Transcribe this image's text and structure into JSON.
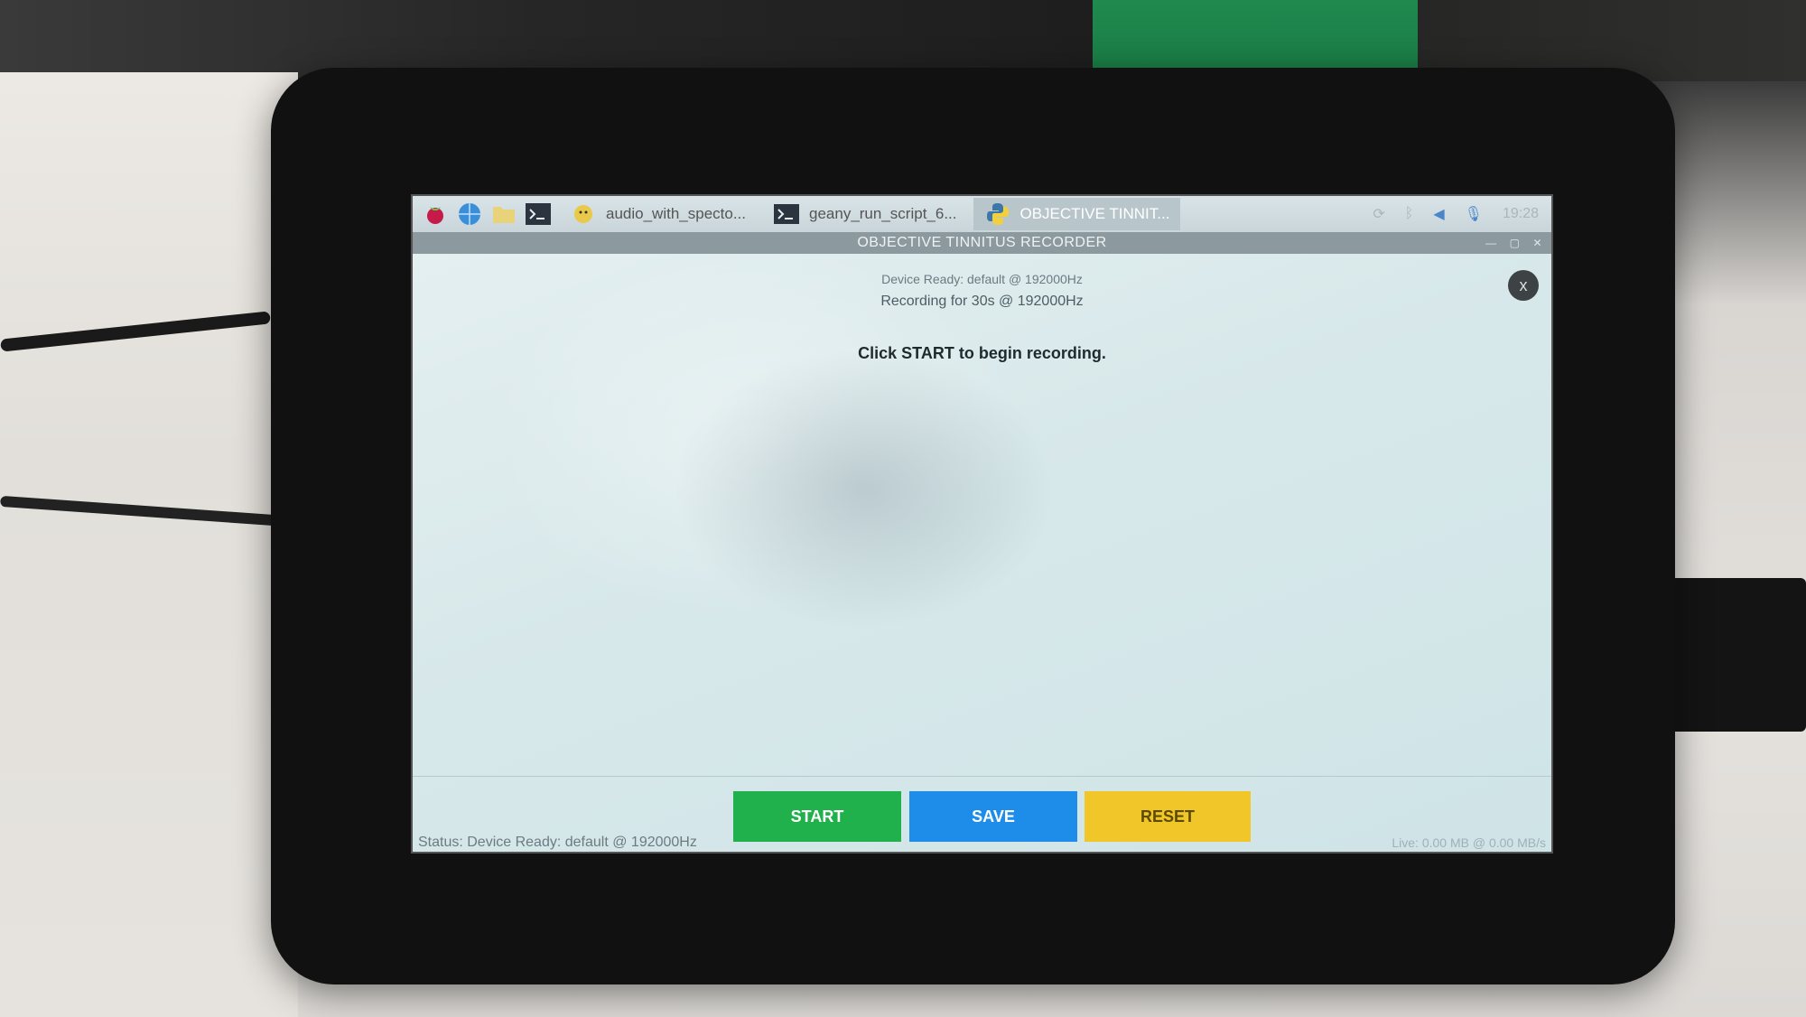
{
  "taskbar": {
    "launchers": [
      "raspberry-menu-icon",
      "web-browser-icon",
      "file-manager-icon",
      "terminal-icon"
    ],
    "tasks": [
      {
        "label": "audio_with_specto...",
        "icon": "python-editor-icon",
        "active": false
      },
      {
        "label": "geany_run_script_6...",
        "icon": "terminal-icon",
        "active": false
      },
      {
        "label": "OBJECTIVE TINNIT...",
        "icon": "python-icon",
        "active": true
      }
    ],
    "clock": "19:28"
  },
  "window": {
    "title": "OBJECTIVE TINNITUS RECORDER"
  },
  "main": {
    "device_ready": "Device Ready: default @ 192000Hz",
    "recording_for": "Recording for 30s @ 192000Hz",
    "instruction": "Click START to begin recording.",
    "close_label": "x"
  },
  "buttons": {
    "start": "START",
    "save": "SAVE",
    "reset": "RESET"
  },
  "status": {
    "text": "Status: Device Ready: default @ 192000Hz",
    "live": "Live: 0.00 MB @ 0.00 MB/s"
  },
  "colors": {
    "start": "#21b14c",
    "save": "#1e8de9",
    "reset": "#f0c628"
  }
}
